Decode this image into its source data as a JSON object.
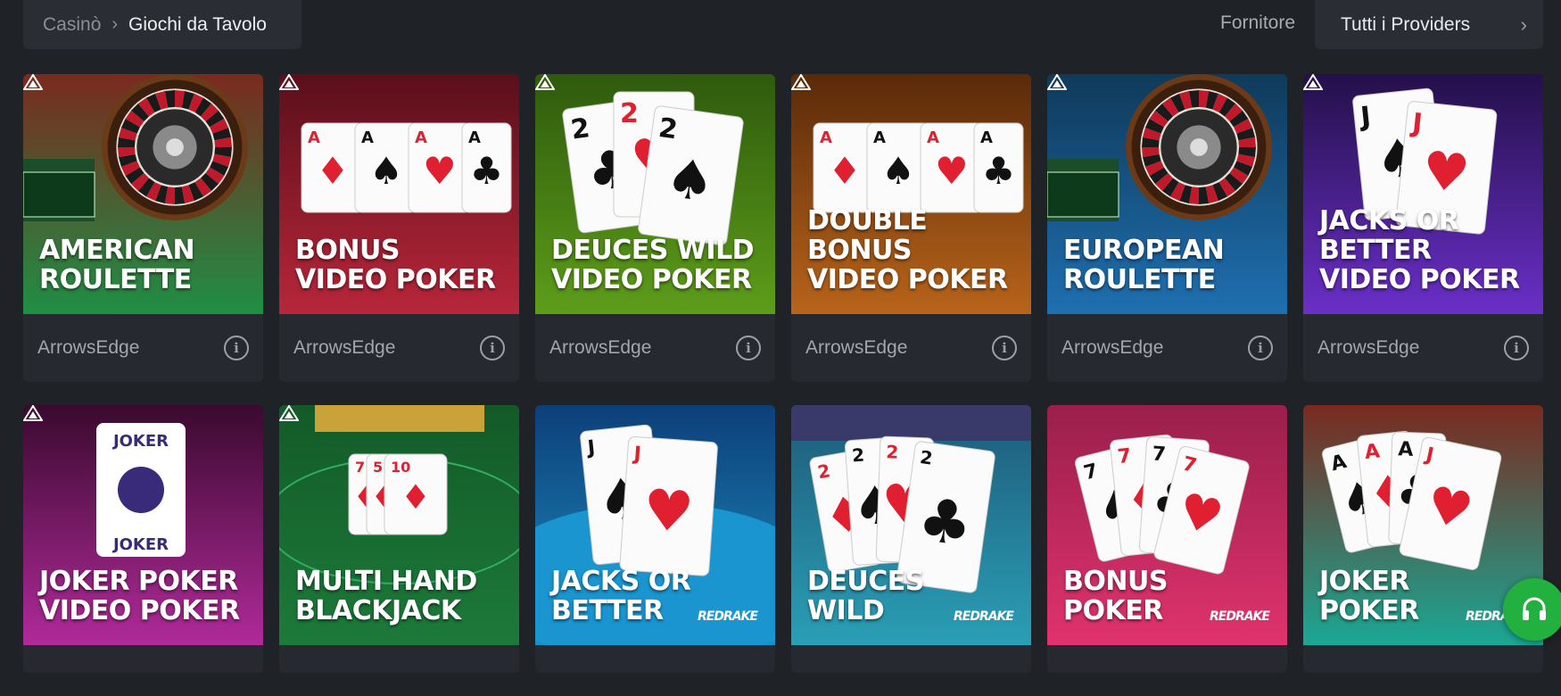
{
  "breadcrumb": {
    "home": "Casinò",
    "separator": "›",
    "current": "Giochi da Tavolo"
  },
  "filter": {
    "label": "Fornitore",
    "selected": "Tutti i Providers",
    "chevron": "›"
  },
  "info_symbol": "i",
  "games": [
    {
      "lines": [
        "AMERICAN",
        "ROULETTE"
      ],
      "provider": "ArrowsEdge"
    },
    {
      "lines": [
        "BONUS",
        "VIDEO POKER"
      ],
      "provider": "ArrowsEdge"
    },
    {
      "lines": [
        "DEUCES WILD",
        "VIDEO POKER"
      ],
      "provider": "ArrowsEdge"
    },
    {
      "lines": [
        "DOUBLE BONUS",
        "VIDEO POKER"
      ],
      "provider": "ArrowsEdge"
    },
    {
      "lines": [
        "EUROPEAN",
        "ROULETTE"
      ],
      "provider": "ArrowsEdge"
    },
    {
      "lines": [
        "JACKS OR BETTER",
        "VIDEO POKER"
      ],
      "provider": "ArrowsEdge"
    },
    {
      "lines": [
        "JOKER POKER",
        "VIDEO POKER"
      ],
      "provider": ""
    },
    {
      "lines": [
        "MULTI HAND",
        "BLACKJACK"
      ],
      "provider": ""
    },
    {
      "lines": [
        "JACKS OR",
        "BETTER"
      ],
      "provider": ""
    },
    {
      "lines": [
        "DEUCES",
        "WILD"
      ],
      "provider": ""
    },
    {
      "lines": [
        "BONUS",
        "POKER"
      ],
      "provider": ""
    },
    {
      "lines": [
        "JOKER",
        "POKER"
      ],
      "provider": ""
    }
  ],
  "brand_marks": {
    "redrake": "REDRAKE"
  },
  "colors": {
    "green": "#1f8f45",
    "red": "#b8263a",
    "lime": "#5d9d1a",
    "orange": "#b8641a",
    "blue": "#1f6fb0",
    "purple": "#6a2fc8",
    "magenta": "#b02a9a",
    "felt": "#1d7a3a",
    "cyan": "#1d8fbf",
    "teal": "#2a9fb5",
    "pink": "#e0336e",
    "turq": "#1aa894",
    "support": "#22b13e"
  }
}
